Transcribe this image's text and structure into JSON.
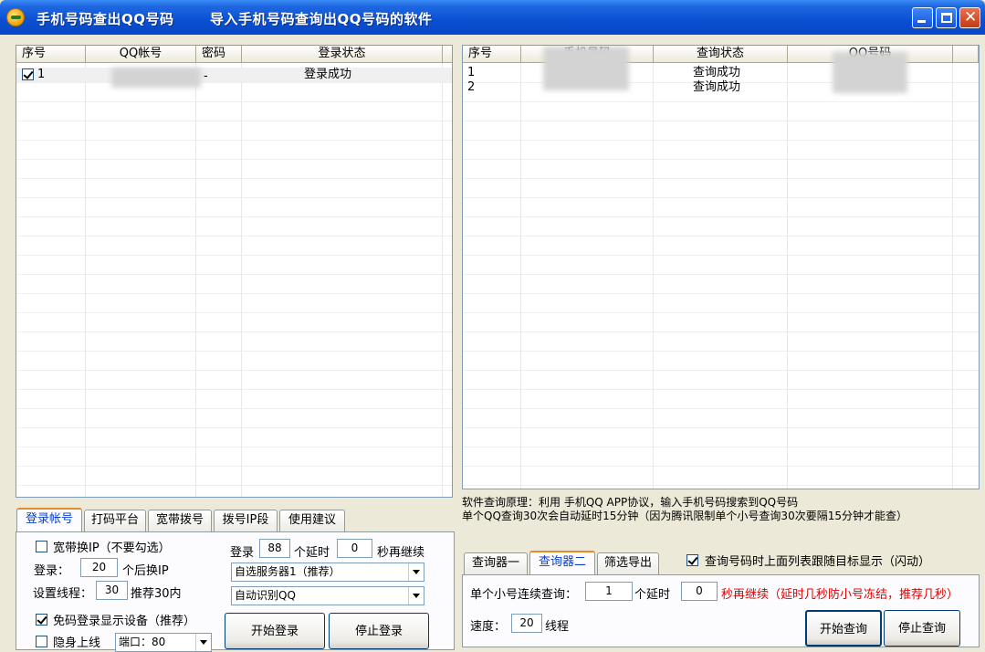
{
  "window": {
    "title": "手机号码查出QQ号码",
    "subtitle": "导入手机号码查询出QQ号码的软件"
  },
  "left_list": {
    "columns": [
      "序号",
      "QQ帐号",
      "密码",
      "登录状态"
    ],
    "rows": [
      {
        "index": "1",
        "checked": true,
        "account": "",
        "password": "-",
        "status": "登录成功"
      }
    ]
  },
  "right_list": {
    "columns": [
      "序号",
      "手机号码",
      "查询状态",
      "QQ号码"
    ],
    "rows": [
      {
        "index": "1",
        "phone": "",
        "status": "查询成功",
        "qq": ""
      },
      {
        "index": "2",
        "phone": "",
        "status": "查询成功",
        "qq": ""
      }
    ]
  },
  "info": {
    "line1": "软件查询原理：利用 手机QQ APP协议，输入手机号码搜索到QQ号码",
    "line2": "单个QQ查询30次会自动延时15分钟（因为腾讯限制单个小号查询30次要隔15分钟才能查）"
  },
  "left_tabs": [
    "登录帐号",
    "打码平台",
    "宽带拨号",
    "拨号IP段",
    "使用建议"
  ],
  "login_panel": {
    "broadband_ip_label": "宽带换IP（不要勾选）",
    "login_label": "登录：",
    "login_value": "20",
    "change_ip_label": "个后换IP",
    "threads_label": "设置线程：",
    "threads_value": "30",
    "threads_hint": "推荐30内",
    "login2_label": "登录",
    "login2_value": "88",
    "delay_label": "个延时",
    "delay_value": "0",
    "continue_label": "秒再继续",
    "server_select": "自选服务器1（推荐）",
    "qq_select": "自动识别QQ",
    "device_label": "免码登录显示设备（推荐）",
    "hidden_label": "隐身上线",
    "port_select": "端口：80",
    "start_login": "开始登录",
    "stop_login": "停止登录"
  },
  "right_tabs": [
    "查询器一",
    "查询器二",
    "筛选导出"
  ],
  "follow_label": "查询号码时上面列表跟随目标显示（闪动）",
  "query_panel": {
    "consecutive_label": "单个小号连续查询：",
    "consecutive_value": "1",
    "delay_label": "个延时",
    "delay_value": "0",
    "continue_warning": "秒再继续（延时几秒防小号冻结，推荐几秒）",
    "speed_label": "速度：",
    "speed_value": "20",
    "threads_label": "线程",
    "start_query": "开始查询",
    "stop_query": "停止查询"
  }
}
